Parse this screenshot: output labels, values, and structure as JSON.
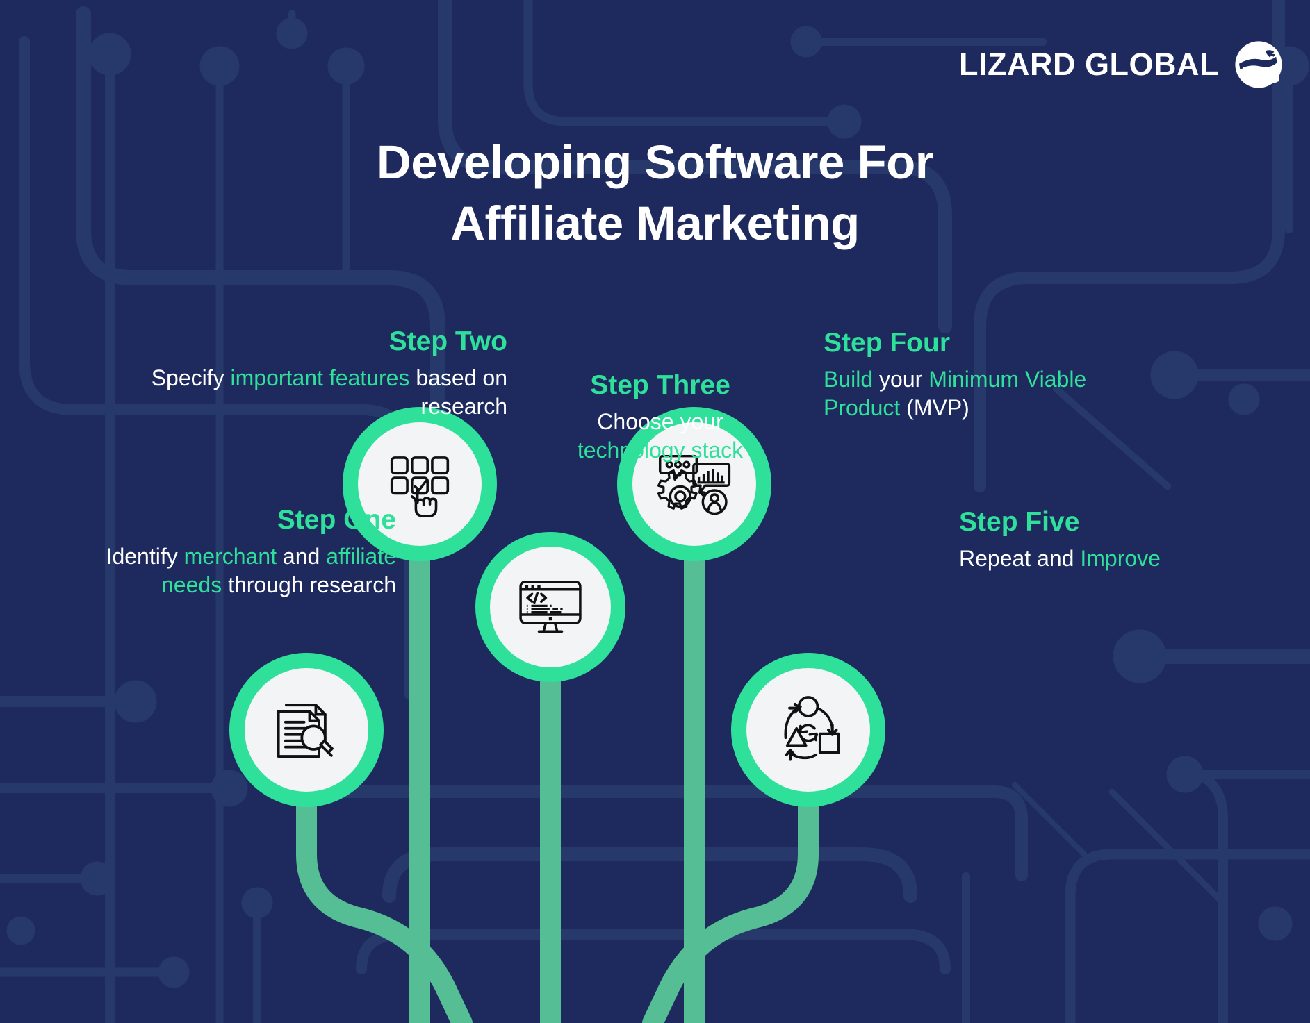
{
  "brand": {
    "wordmark": "LIZARD GLOBAL",
    "logo_icon": "lizard-circle-mark",
    "colors": {
      "background_navy": "#1E2A5E",
      "circuit_trace": "#27396B",
      "accent_green": "#2FE09B",
      "stem_green": "#55BE95",
      "node_face": "#F2F4F6",
      "text_white": "#FFFFFF"
    }
  },
  "title": {
    "line1": "Developing Software For",
    "line2": "Affiliate Marketing"
  },
  "steps": [
    {
      "id": "step-one",
      "heading": "Step One",
      "body_parts": [
        {
          "text": "Identify ",
          "accent": false
        },
        {
          "text": "merchant",
          "accent": true
        },
        {
          "text": " and ",
          "accent": false
        },
        {
          "text": "affiliate needs",
          "accent": true
        },
        {
          "text": " through research",
          "accent": false
        }
      ],
      "icon": "document-magnifier-icon",
      "icon_meaning": "research document with magnifying glass"
    },
    {
      "id": "step-two",
      "heading": "Step Two",
      "body_parts": [
        {
          "text": "Specify ",
          "accent": false
        },
        {
          "text": "important features",
          "accent": true
        },
        {
          "text": " based on research",
          "accent": false
        }
      ],
      "icon": "grid-checkbox-cursor-icon",
      "icon_meaning": "feature grid with checkmark and pointing hand"
    },
    {
      "id": "step-three",
      "heading": "Step Three",
      "body_parts": [
        {
          "text": "Choose your ",
          "accent": false
        },
        {
          "text": "technology stack",
          "accent": true
        }
      ],
      "icon": "monitor-code-icon",
      "icon_meaning": "desktop monitor displaying code brackets"
    },
    {
      "id": "step-four",
      "heading": "Step Four",
      "body_parts": [
        {
          "text": "Build",
          "accent": true
        },
        {
          "text": " your ",
          "accent": false
        },
        {
          "text": "Minimum Viable Product",
          "accent": true
        },
        {
          "text": " (MVP)",
          "accent": false
        }
      ],
      "icon": "gear-chat-chart-user-icon",
      "icon_meaning": "gear with chat bubbles, bar chart and user avatar"
    },
    {
      "id": "step-five",
      "heading": "Step Five",
      "body_parts": [
        {
          "text": "Repeat and ",
          "accent": false
        },
        {
          "text": "Improve",
          "accent": true
        }
      ],
      "icon": "iteration-cycle-icon",
      "icon_meaning": "circle triangle square with refresh arrows"
    }
  ]
}
